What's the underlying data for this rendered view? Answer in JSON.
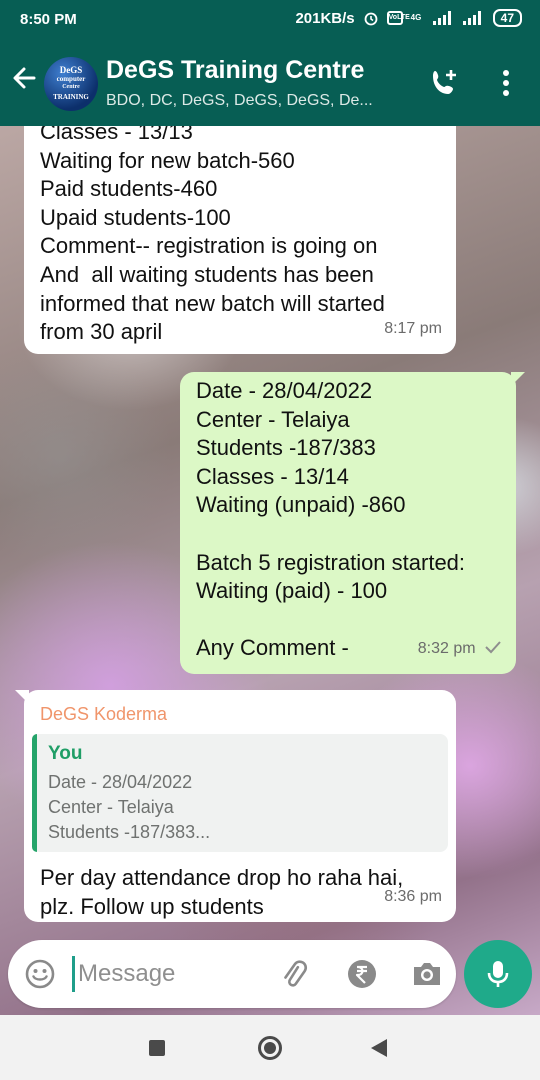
{
  "status_bar": {
    "time": "8:50 PM",
    "speed": "201KB/s",
    "volte": "VoLTE",
    "network": "4G",
    "battery": "47"
  },
  "header": {
    "title": "DeGS Training Centre",
    "subtitle": "BDO, DC, DeGS, DeGS, DeGS, De...",
    "avatar_text": [
      "DeGS",
      "computer",
      "Centre",
      "TRAINING"
    ]
  },
  "messages": [
    {
      "direction": "incoming",
      "lines": [
        "Classes - 13/13",
        "Waiting for new batch-560",
        "Paid students-460",
        "Upaid students-100",
        "Comment-- registration is going on",
        "And  all waiting students has been",
        "informed that new batch will started",
        "from 30 april"
      ],
      "time": "8:17 pm"
    },
    {
      "direction": "outgoing",
      "lines": [
        "Date - 28/04/2022",
        "Center - Telaiya",
        "Students -187/383",
        "Classes - 13/14",
        "Waiting (unpaid) -860",
        "",
        "Batch 5 registration started:",
        "Waiting (paid) - 100",
        "",
        "Any Comment -"
      ],
      "time": "8:32 pm",
      "status": "sent"
    },
    {
      "direction": "incoming",
      "sender": "DeGS Koderma",
      "quote": {
        "author": "You",
        "lines": [
          "Date - 28/04/2022",
          "Center - Telaiya",
          "Students -187/383..."
        ]
      },
      "lines": [
        "Per day attendance drop ho raha hai,",
        "plz. Follow up students"
      ],
      "time": "8:36 pm"
    }
  ],
  "composer": {
    "placeholder": "Message"
  },
  "colors": {
    "header": "#075e54",
    "outgoing_bubble": "#dcf8c6",
    "incoming_bubble": "#ffffff",
    "mic_button": "#1faa8a",
    "sender_name": "#f0956b",
    "quote_author": "#1f9e66"
  },
  "icons": [
    "back-arrow-icon",
    "add-call-icon",
    "more-vert-icon",
    "emoji-icon",
    "attach-icon",
    "rupee-icon",
    "camera-icon",
    "mic-icon",
    "check-icon"
  ]
}
